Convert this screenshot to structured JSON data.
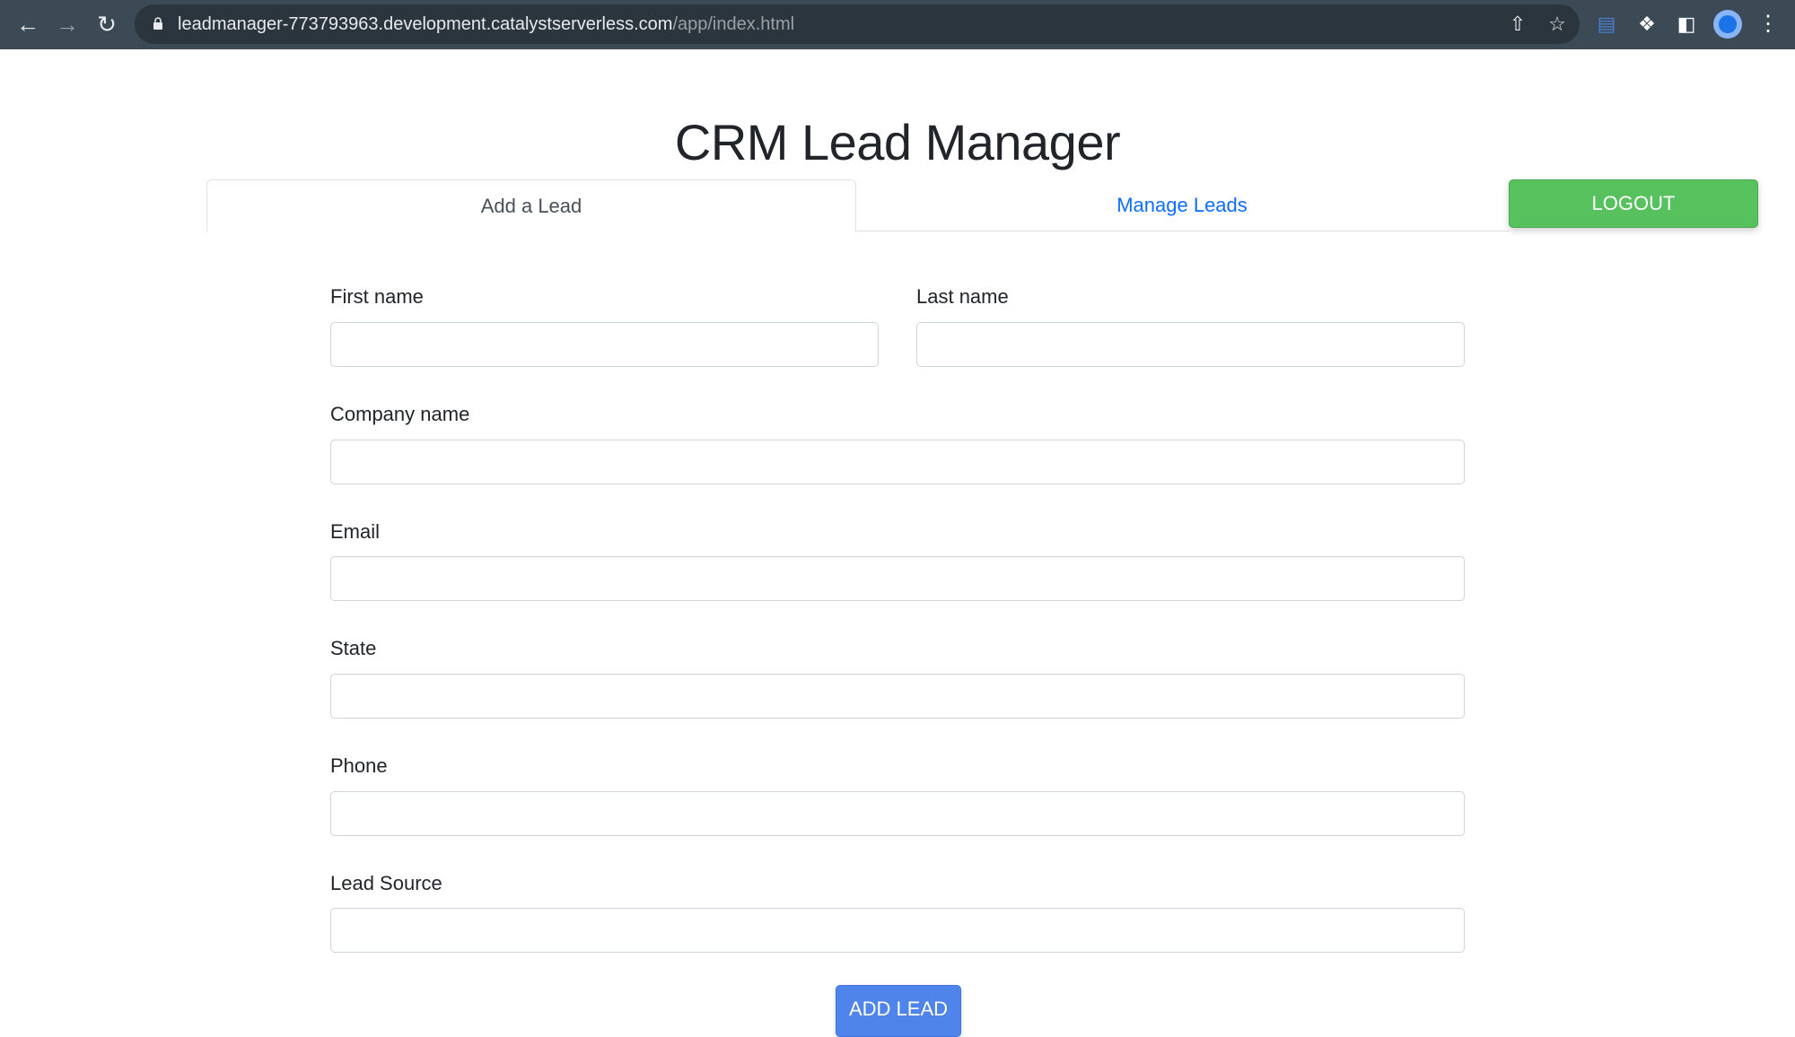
{
  "browser": {
    "url_host": "leadmanager-773793963.development.catalystserverless.com",
    "url_path": "/app/index.html",
    "icons": {
      "back": "arrow-left-icon",
      "forward": "arrow-right-icon",
      "reload": "reload-icon",
      "lock": "lock-icon",
      "share": "share-icon",
      "bookmark": "star-icon",
      "extension_1": "extension-app-icon",
      "extensions": "puzzle-icon",
      "side_panel": "side-panel-icon",
      "profile": "profile-avatar-icon",
      "menu": "kebab-menu-icon"
    }
  },
  "page": {
    "title": "CRM Lead Manager",
    "tabs": [
      {
        "label": "Add a Lead",
        "active": true
      },
      {
        "label": "Manage Leads",
        "active": false
      }
    ],
    "logout_label": "LOGOUT",
    "form": {
      "fields": [
        {
          "label": "First name",
          "value": "",
          "placeholder": ""
        },
        {
          "label": "Last name",
          "value": "",
          "placeholder": ""
        },
        {
          "label": "Company name",
          "value": "",
          "placeholder": ""
        },
        {
          "label": "Email",
          "value": "",
          "placeholder": ""
        },
        {
          "label": "State",
          "value": "",
          "placeholder": ""
        },
        {
          "label": "Phone",
          "value": "",
          "placeholder": ""
        },
        {
          "label": "Lead Source",
          "value": "",
          "placeholder": ""
        }
      ],
      "submit_label": "ADD LEAD"
    },
    "colors": {
      "logout_green": "#57c15e",
      "submit_blue": "#4f84ea",
      "link_blue": "#0d6efd"
    }
  }
}
